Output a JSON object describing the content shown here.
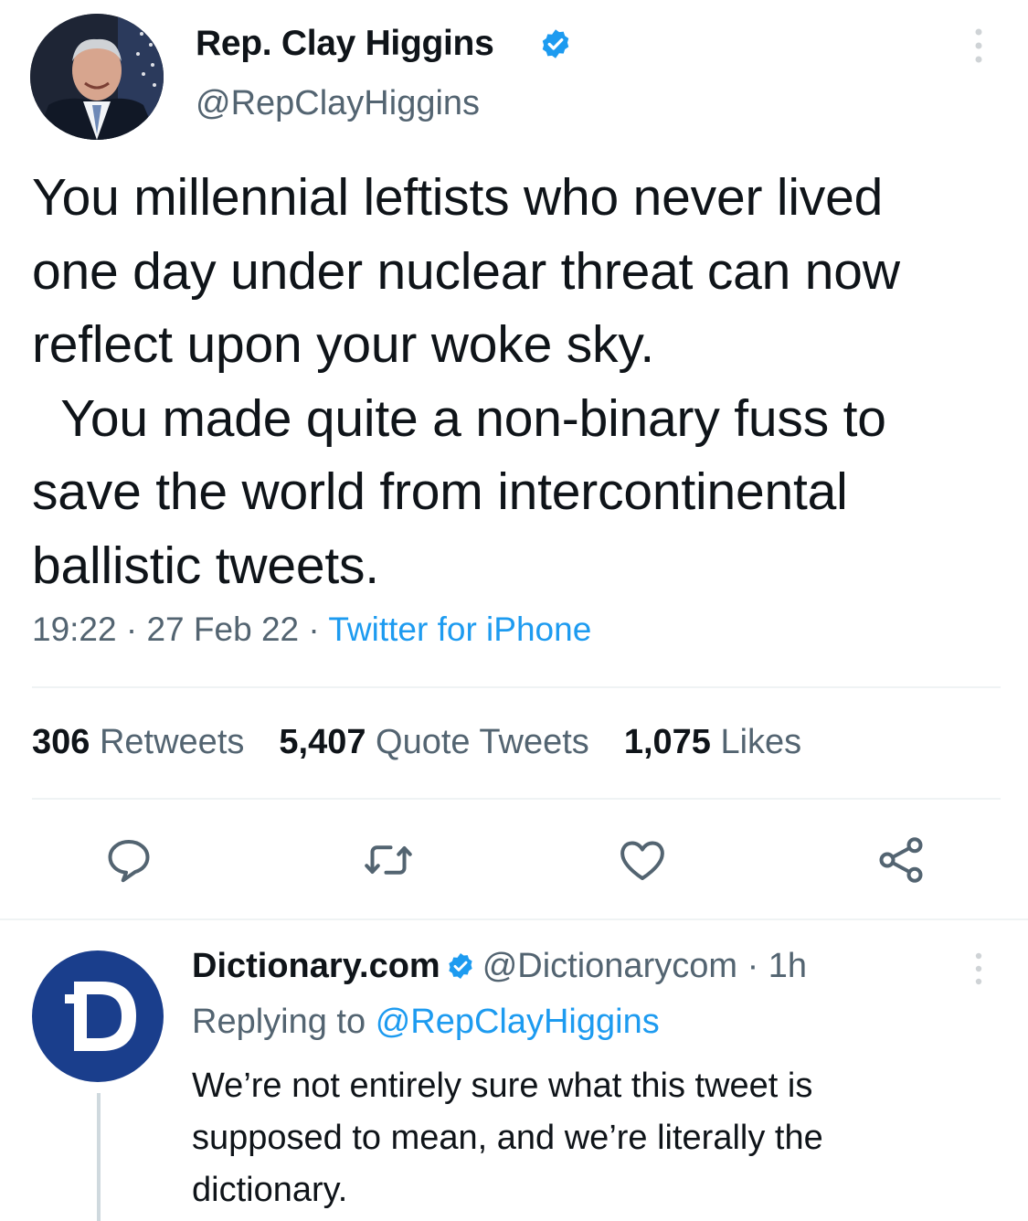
{
  "tweet": {
    "author": {
      "name": "Rep. Clay Higgins",
      "handle": "@RepClayHiggins",
      "verified": true
    },
    "text": "You millennial leftists who never lived\none day under nuclear threat can now\nreflect upon your woke sky.\n  You made quite a non-binary fuss to\nsave the world from intercontinental\nballistic tweets.",
    "time": "19:22",
    "date": "27 Feb 22",
    "separator": "·",
    "source": "Twitter for iPhone",
    "stats": {
      "retweets_count": "306",
      "retweets_label": "Retweets",
      "quotes_count": "5,407",
      "quotes_label": "Quote Tweets",
      "likes_count": "1,075",
      "likes_label": "Likes"
    },
    "actions": [
      "reply-icon",
      "retweet-icon",
      "like-icon",
      "share-icon"
    ]
  },
  "reply": {
    "author": {
      "name": "Dictionary.com",
      "handle": "@Dictionarycom",
      "verified": true
    },
    "time_ago": "1h",
    "separator": "·",
    "replying_prefix": "Replying to",
    "replying_to": "@RepClayHiggins",
    "text": "We’re not entirely sure what this tweet is\nsupposed to mean, and we’re literally the\ndictionary."
  },
  "colors": {
    "text": "#0f1419",
    "secondary": "#536471",
    "accent": "#1d9bf0",
    "divider": "#eff3f4",
    "dictionary_blue": "#1a3e8c"
  }
}
